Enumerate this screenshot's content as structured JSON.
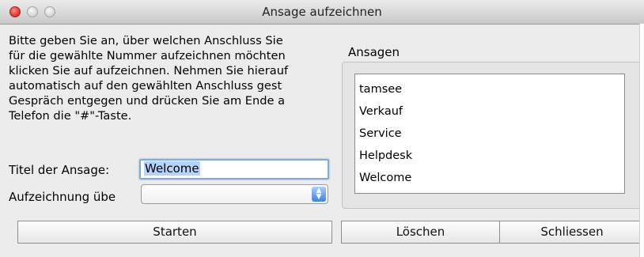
{
  "window": {
    "title": "Ansage aufzeichnen"
  },
  "instructions": [
    "Bitte geben Sie an, über welchen Anschluss Sie",
    "für die gewählte Nummer aufzeichnen möchten",
    "klicken Sie auf aufzeichnen. Nehmen Sie hierauf",
    "automatisch auf den gewählten Anschluss gest",
    "Gespräch entgegen und drücken Sie am Ende a",
    "Telefon die \"#\"-Taste."
  ],
  "form": {
    "title_label": "Titel der Ansage:",
    "title_value": "Welcome",
    "record_via_label": "Aufzeichnung übe",
    "record_via_value": ""
  },
  "announcements": {
    "label": "Ansagen",
    "items": [
      "tamsee",
      "Verkauf",
      "Service",
      "Helpdesk",
      "Welcome"
    ]
  },
  "buttons": {
    "start": "Starten",
    "delete": "Löschen",
    "close": "Schliessen"
  },
  "icons": {
    "select_arrows": "updown-arrows-icon"
  }
}
